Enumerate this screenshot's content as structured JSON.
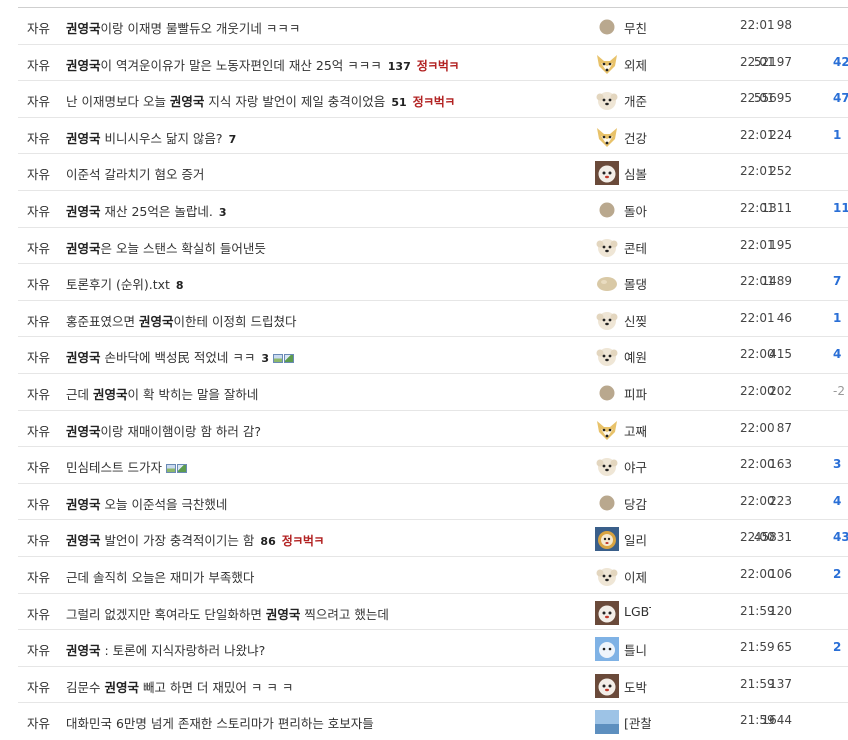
{
  "posts": [
    {
      "category": "자유",
      "segments": [
        {
          "t": "권영국",
          "b": true
        },
        {
          "t": "이랑 이재명 물빨듀오 개웃기네 ㅋㅋㅋ",
          "b": false
        }
      ],
      "count": "",
      "badge": "",
      "icons": false,
      "avatar": "dot",
      "author": "무친",
      "time": "22:01",
      "views": "98",
      "recommend": ""
    },
    {
      "category": "자유",
      "segments": [
        {
          "t": "권영국",
          "b": true
        },
        {
          "t": "이 역겨운이유가 말은 노동자편인데 재산 25억 ㅋㅋㅋ",
          "b": false
        }
      ],
      "count": "137",
      "badge": "정ㅋ벅ㅋ",
      "icons": false,
      "avatar": "fox",
      "author": "외제",
      "time": "22:01",
      "views": "52197",
      "recommend": "42"
    },
    {
      "category": "자유",
      "segments": [
        {
          "t": "난 이재명보다 오늘 ",
          "b": false
        },
        {
          "t": "권영국",
          "b": true
        },
        {
          "t": " 지식 자랑 발언이 제일 충격이었음",
          "b": false
        }
      ],
      "count": "51",
      "badge": "정ㅋ벅ㅋ",
      "icons": false,
      "avatar": "pup",
      "author": "개준",
      "time": "22:01",
      "views": "55695",
      "recommend": "47"
    },
    {
      "category": "자유",
      "segments": [
        {
          "t": "권영국",
          "b": true
        },
        {
          "t": " 비니시우스 닮지 않음?",
          "b": false
        }
      ],
      "count": "7",
      "badge": "",
      "icons": false,
      "avatar": "fox",
      "author": "건강",
      "time": "22:01",
      "views": "224",
      "recommend": "1"
    },
    {
      "category": "자유",
      "segments": [
        {
          "t": "이준석 갈라치기 혐오 증거",
          "b": false
        }
      ],
      "count": "",
      "badge": "",
      "icons": false,
      "avatar": "bear",
      "author": "심볼",
      "time": "22:01",
      "views": "252",
      "recommend": ""
    },
    {
      "category": "자유",
      "segments": [
        {
          "t": "권영국",
          "b": true
        },
        {
          "t": " 재산 25억은 놀랍네.",
          "b": false
        }
      ],
      "count": "3",
      "badge": "",
      "icons": false,
      "avatar": "dot",
      "author": "돌아",
      "time": "22:01",
      "views": "1311",
      "recommend": "11"
    },
    {
      "category": "자유",
      "segments": [
        {
          "t": "권영국",
          "b": true
        },
        {
          "t": "은 오늘 스탠스 확실히 들어낸듯",
          "b": false
        }
      ],
      "count": "",
      "badge": "",
      "icons": false,
      "avatar": "pup",
      "author": "콘테",
      "time": "22:01",
      "views": "195",
      "recommend": ""
    },
    {
      "category": "자유",
      "segments": [
        {
          "t": "토론후기 (순위).txt",
          "b": false
        }
      ],
      "count": "8",
      "badge": "",
      "icons": false,
      "avatar": "blob",
      "author": "몰댕",
      "time": "22:01",
      "views": "1489",
      "recommend": "7"
    },
    {
      "category": "자유",
      "segments": [
        {
          "t": "홍준표였으면 ",
          "b": false
        },
        {
          "t": "권영국",
          "b": true
        },
        {
          "t": "이한테 이정희 드립쳤다",
          "b": false
        }
      ],
      "count": "",
      "badge": "",
      "icons": false,
      "avatar": "pup",
      "author": "신찢",
      "time": "22:01",
      "views": "46",
      "recommend": "1"
    },
    {
      "category": "자유",
      "segments": [
        {
          "t": "권영국",
          "b": true
        },
        {
          "t": " 손바닥에 백성民 적었네 ㅋㅋ",
          "b": false
        }
      ],
      "count": "3",
      "badge": "",
      "icons": true,
      "avatar": "pup",
      "author": "예원",
      "time": "22:00",
      "views": "415",
      "recommend": "4"
    },
    {
      "category": "자유",
      "segments": [
        {
          "t": "근데 ",
          "b": false
        },
        {
          "t": "권영국",
          "b": true
        },
        {
          "t": "이 확 박히는 말을 잘하네",
          "b": false
        }
      ],
      "count": "",
      "badge": "",
      "icons": false,
      "avatar": "dot",
      "author": "피파",
      "time": "22:00",
      "views": "202",
      "recommend": "-2"
    },
    {
      "category": "자유",
      "segments": [
        {
          "t": "권영국",
          "b": true
        },
        {
          "t": "이랑 재매이햄이랑 함 하러 감?",
          "b": false
        }
      ],
      "count": "",
      "badge": "",
      "icons": false,
      "avatar": "fox",
      "author": "고째",
      "time": "22:00",
      "views": "87",
      "recommend": ""
    },
    {
      "category": "자유",
      "segments": [
        {
          "t": "민심테스트 드가자",
          "b": false
        }
      ],
      "count": "",
      "badge": "",
      "icons": true,
      "avatar": "pup",
      "author": "야구",
      "time": "22:00",
      "views": "163",
      "recommend": "3"
    },
    {
      "category": "자유",
      "segments": [
        {
          "t": "권영국",
          "b": true
        },
        {
          "t": " 오늘 이준석을 극찬했네",
          "b": false
        }
      ],
      "count": "",
      "badge": "",
      "icons": false,
      "avatar": "dot",
      "author": "당감",
      "time": "22:00",
      "views": "223",
      "recommend": "4"
    },
    {
      "category": "자유",
      "segments": [
        {
          "t": "권영국",
          "b": true
        },
        {
          "t": " 발언이 가장 충격적이기는 함",
          "b": false
        }
      ],
      "count": "86",
      "badge": "정ㅋ벅ㅋ",
      "icons": false,
      "avatar": "lion",
      "author": "일리",
      "time": "22:00",
      "views": "45831",
      "recommend": "43"
    },
    {
      "category": "자유",
      "segments": [
        {
          "t": "근데 솔직히 오늘은 재미가 부족했다",
          "b": false
        }
      ],
      "count": "",
      "badge": "",
      "icons": false,
      "avatar": "pup",
      "author": "이제",
      "time": "22:00",
      "views": "106",
      "recommend": "2"
    },
    {
      "category": "자유",
      "segments": [
        {
          "t": "그럴리 없겠지만 혹여라도 단일화하면 ",
          "b": false
        },
        {
          "t": "권영국",
          "b": true
        },
        {
          "t": " 찍으려고 했는데",
          "b": false
        }
      ],
      "count": "",
      "badge": "",
      "icons": false,
      "avatar": "bear",
      "author": "LGBT",
      "time": "21:59",
      "views": "120",
      "recommend": ""
    },
    {
      "category": "자유",
      "segments": [
        {
          "t": "권영국",
          "b": true
        },
        {
          "t": " : 토론에 지식자랑하러 나왔냐?",
          "b": false
        }
      ],
      "count": "",
      "badge": "",
      "icons": false,
      "avatar": "blue",
      "author": "틀니",
      "time": "21:59",
      "views": "65",
      "recommend": "2"
    },
    {
      "category": "자유",
      "segments": [
        {
          "t": "김문수 ",
          "b": false
        },
        {
          "t": "권영국",
          "b": true
        },
        {
          "t": " 빼고 하면 더 재밌어 ㅋ ㅋ ㅋ",
          "b": false
        }
      ],
      "count": "",
      "badge": "",
      "icons": false,
      "avatar": "bear",
      "author": "도박",
      "time": "21:59",
      "views": "137",
      "recommend": ""
    },
    {
      "category": "자유",
      "segments": [
        {
          "t": "대화민국 6만명 넘게 존재한 스토리마가 편리하는 호보자들",
          "b": false
        }
      ],
      "count": "",
      "badge": "",
      "icons": false,
      "avatar": "img",
      "author": "[관찰",
      "time": "21:59",
      "views": "1644",
      "recommend": ""
    }
  ],
  "colors": {
    "badge": "#b22222",
    "recommend": "#2a6fd6",
    "divider": "#e6e6e6"
  }
}
